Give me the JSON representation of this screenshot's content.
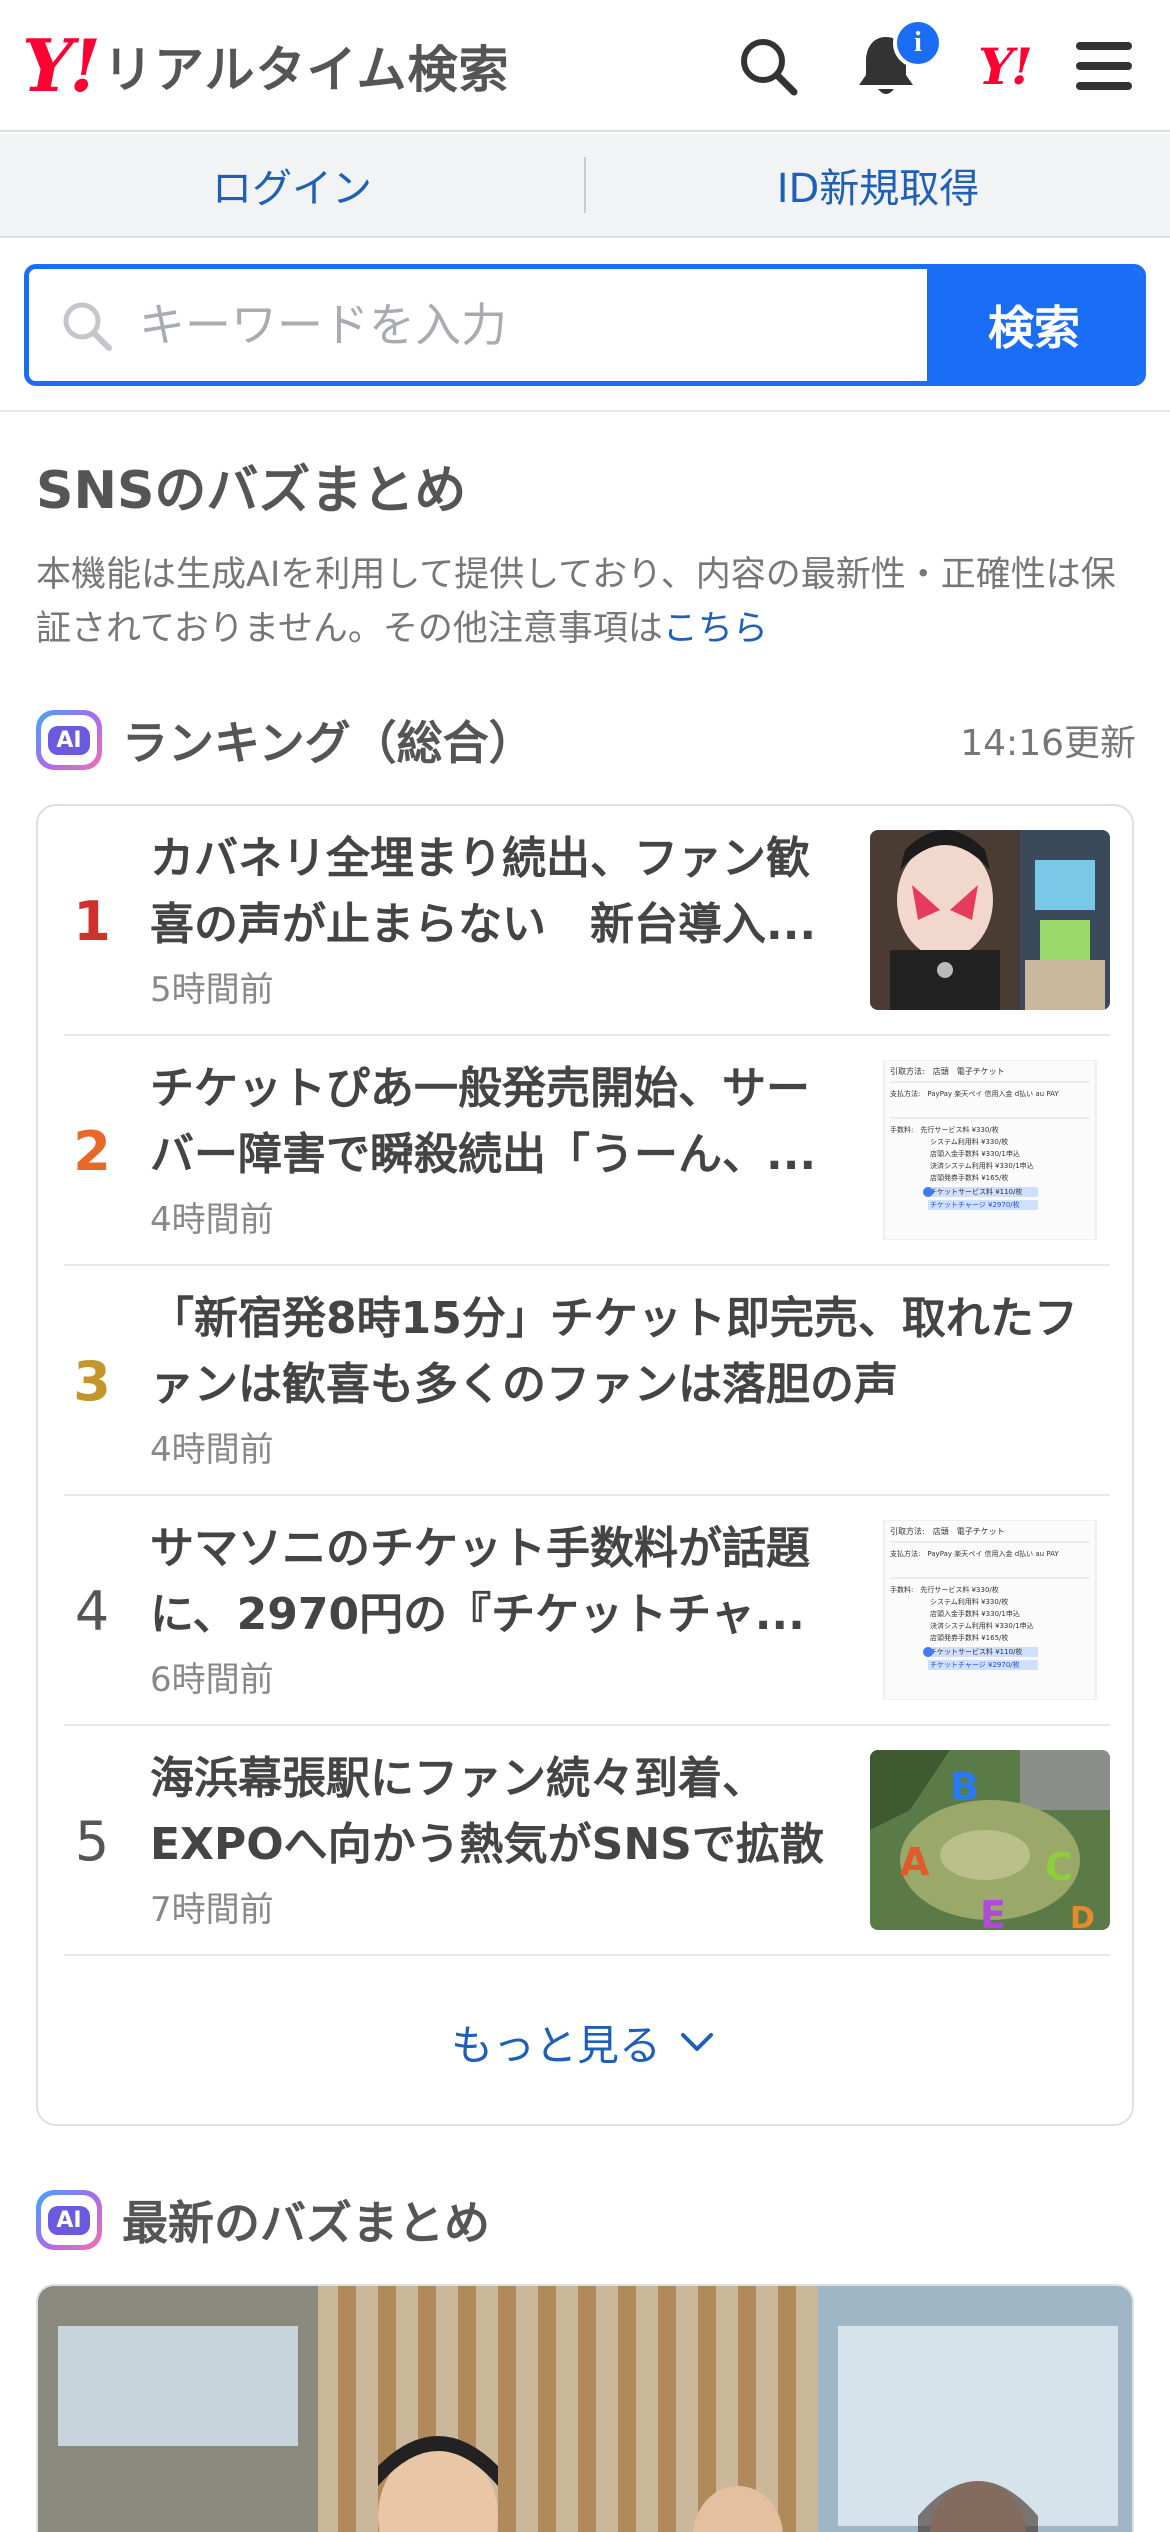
{
  "header": {
    "logo_mark": "Y!",
    "logo_text": "リアルタイム検索",
    "notification_badge": "i",
    "yj_mark": "Y!"
  },
  "account": {
    "login": "ログイン",
    "signup": "ID新規取得"
  },
  "search": {
    "placeholder": "キーワードを入力",
    "button": "検索"
  },
  "section": {
    "title": "SNSのバズまとめ",
    "disclaimer": "本機能は生成AIを利用して提供しており、内容の最新性・正確性は保証されておりません。その他注意事項は",
    "disclaimer_link": "こちら"
  },
  "ranking": {
    "ai_label": "AI",
    "title": "ランキング（総合）",
    "updated": "14:16更新",
    "items": [
      {
        "rank": "1",
        "rank_color": "#d0312d",
        "title": "カバネリ全埋まり続出、ファン歓喜の声が止まらない　新台導入...",
        "time": "5時間前"
      },
      {
        "rank": "2",
        "rank_color": "#e8682a",
        "title": "チケットぴあ一般発売開始、サーバー障害で瞬殺続出「うーん、...",
        "time": "4時間前"
      },
      {
        "rank": "3",
        "rank_color": "#c4952a",
        "title": "「新宿発8時15分」チケット即完売、取れたファンは歓喜も多くのファンは落胆の声",
        "time": "4時間前"
      },
      {
        "rank": "4",
        "rank_color": "#555555",
        "title": "サマソニのチケット手数料が話題に、2970円の『チケットチャ...",
        "time": "6時間前"
      },
      {
        "rank": "5",
        "rank_color": "#555555",
        "title": "海浜幕張駅にファン続々到着、EXPOへ向かう熱気がSNSで拡散",
        "time": "7時間前"
      }
    ],
    "thumb_texts": {
      "ticket_lines": [
        "引取方法:　店頭　電子チケット",
        "支払方法:　PayPay 楽天ペイ 信用入金 d払い au PAY",
        "手数料:　先行サービス料 ¥330/枚",
        "システム利用料 ¥330/枚",
        "店頭入金手数料 ¥330/1申込",
        "決済システム利用料 ¥330/1申込",
        "店頭発券手数料 ¥165/枚",
        "チケットサービス料 ¥110/枚",
        "チケットチャージ ¥2970/枚"
      ],
      "map_labels": [
        "A",
        "B",
        "C",
        "E",
        "D"
      ]
    },
    "more": "もっと見る"
  },
  "latest": {
    "ai_label": "AI",
    "title": "最新のバズまとめ"
  }
}
